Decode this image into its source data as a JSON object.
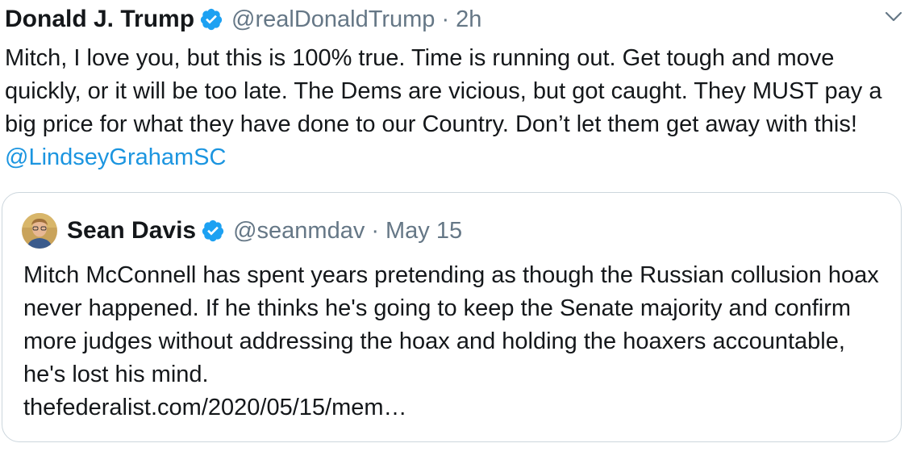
{
  "tweet": {
    "author_name": "Donald J. Trump",
    "handle": "@realDonaldTrump",
    "separator": "·",
    "time": "2h",
    "text": "Mitch, I love you, but this is 100% true. Time is running out. Get tough and move quickly, or it will be too late. The Dems are vicious, but got caught. They MUST pay a big price for what they have done to our Country. Don’t let them get away with this! ",
    "mention": "@LindseyGrahamSC",
    "verified_icon": "verified-badge-icon",
    "menu_icon": "chevron-down-icon"
  },
  "quoted_tweet": {
    "author_name": "Sean Davis",
    "handle": "@seanmdav",
    "separator": "·",
    "time": "May 15",
    "text": "Mitch McConnell has spent years pretending as though the Russian collusion hoax never happened. If he thinks he's going to keep the Senate majority and confirm more judges without addressing the hoax and holding the hoaxers accountable, he's lost his mind.",
    "link": "thefederalist.com/2020/05/15/mem…",
    "avatar_icon": "avatar"
  },
  "colors": {
    "text": "#14171a",
    "secondary": "#657786",
    "link": "#1b95e0",
    "verified": "#1da1f2",
    "border": "#ccd6dd"
  }
}
